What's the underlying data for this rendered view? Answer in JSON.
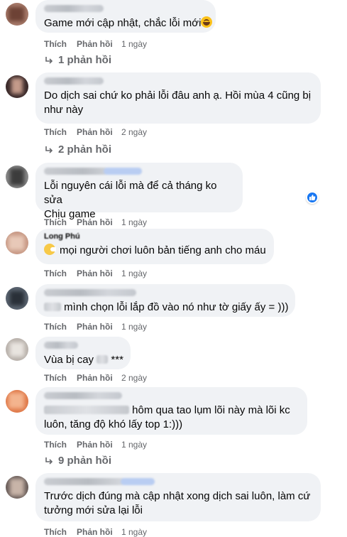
{
  "comments": [
    {
      "text": "Game mới cập nhật, chắc lỗi mới",
      "actions": {
        "like": "Thích",
        "reply": "Phản hồi",
        "time": "1 ngày"
      },
      "replies": "1 phản hồi"
    },
    {
      "text": "Do dịch sai chứ ko phải lỗi đâu anh ạ. Hồi mùa 4 cũng bị như này",
      "actions": {
        "like": "Thích",
        "reply": "Phản hồi",
        "time": "2 ngày"
      },
      "replies": "2 phản hồi"
    },
    {
      "text_line1": "Lỗi nguyên cái lỗi mà để cả tháng ko sửa",
      "text_line2": "Chịu game",
      "actions": {
        "like": "Thích",
        "reply": "Phản hồi",
        "time": "1 ngày"
      }
    },
    {
      "name": "Long Phú",
      "text": "mọi người chơi luôn bản tiếng anh cho máu",
      "actions": {
        "like": "Thích",
        "reply": "Phản hồi",
        "time": "1 ngày"
      }
    },
    {
      "text": "mình chọn lỗi lắp đồ vào nó như tờ giấy ấy = )))",
      "actions": {
        "like": "Thích",
        "reply": "Phản hồi",
        "time": "1 ngày"
      }
    },
    {
      "text_prefix": "Vùa bị cay",
      "text_suffix": "***",
      "actions": {
        "like": "Thích",
        "reply": "Phản hồi",
        "time": "2 ngày"
      }
    },
    {
      "text_line1": "hôm qua tao lụm lõi này mà lõi kc",
      "text_line2": "luôn, tăng độ khó lấy top 1:)))",
      "actions": {
        "like": "Thích",
        "reply": "Phản hồi",
        "time": "1 ngày"
      },
      "replies": "9 phản hồi"
    },
    {
      "text": "Trước dịch đúng mà cập nhật xong dịch sai luôn, làm cứ tưởng mới sửa lại lỗi",
      "actions": {
        "like": "Thích",
        "reply": "Phản hồi",
        "time": "1 ngày"
      }
    }
  ],
  "colors": {
    "bubble": "#f0f2f5",
    "meta": "#65676b",
    "accent": "#1877f2"
  },
  "icons": {
    "reply_arrow": "reply-arrow-icon",
    "like_badge": "like-badge-icon",
    "emoji": "grinning-emoji-icon"
  }
}
